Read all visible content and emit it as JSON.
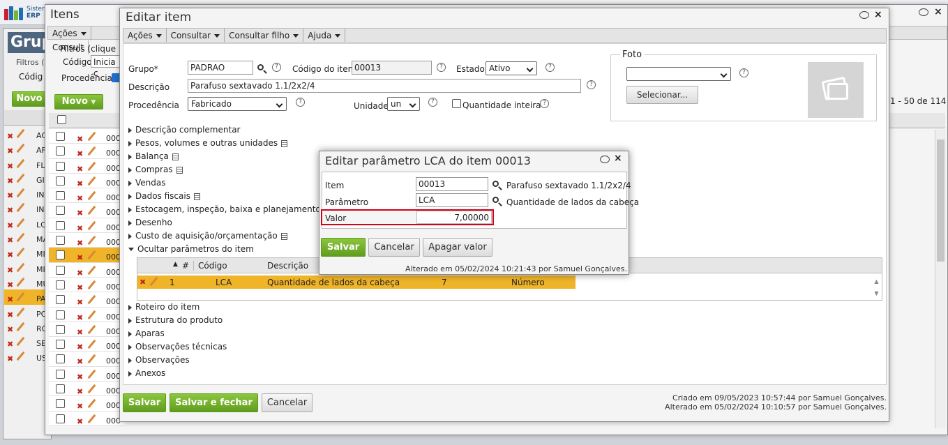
{
  "app": {
    "logo_text_1": "Sister",
    "logo_text_2": "ERP"
  },
  "bg_window": {
    "title": "Grup",
    "filters_label": "Filtros (",
    "codigo_label": "Códig",
    "novo": "Novo",
    "rows": [
      "AC",
      "AF",
      "FL",
      "GI",
      "IN",
      "IN",
      "LC",
      "MA",
      "MI",
      "MI",
      "MU",
      "PA",
      "PC",
      "RÓ",
      "SE",
      "US"
    ]
  },
  "itens_window": {
    "title": "Itens",
    "menu": [
      "Ações",
      "Consult"
    ],
    "filters": "Filtros (clique pa",
    "codigo_label": "Código",
    "codigo_value": "Inicia c",
    "procedencia_label": "Procedência",
    "novo": "Novo",
    "rows": [
      "000",
      "000",
      "000",
      "000",
      "000",
      "000",
      "000",
      "000",
      "000",
      "000",
      "000",
      "000",
      "000",
      "000",
      "000",
      "000",
      "000",
      "000",
      "000",
      "000"
    ],
    "pagination": "1 - 50 de 114"
  },
  "edit_item": {
    "title": "Editar item",
    "menu": [
      "Ações",
      "Consultar",
      "Consultar filho",
      "Ajuda"
    ],
    "grupo_label": "Grupo*",
    "grupo_value": "PADRAO",
    "codigo_label": "Código do item",
    "codigo_value": "00013",
    "estado_label": "Estado",
    "estado_value": "Ativo",
    "descricao_label": "Descrição",
    "descricao_value": "Parafuso sextavado 1.1/2x2/4",
    "procedencia_label": "Procedência",
    "procedencia_value": "Fabricado",
    "unidade_label": "Unidade",
    "unidade_value": "un",
    "quantidade_inteira_label": "Quantidade inteira",
    "foto_label": "Foto",
    "selecionar_label": "Selecionar...",
    "sections_top": [
      {
        "label": "Descrição complementar",
        "doc": false
      },
      {
        "label": "Pesos, volumes e outras unidades",
        "doc": true
      },
      {
        "label": "Balança",
        "doc": true
      },
      {
        "label": "Compras",
        "doc": true
      },
      {
        "label": "Vendas",
        "doc": false
      },
      {
        "label": "Dados fiscais",
        "doc": true
      },
      {
        "label": "Estocagem, inspeção, baixa e planejamento",
        "doc": true
      },
      {
        "label": "Desenho",
        "doc": false
      },
      {
        "label": "Custo de aquisição/orçamentação",
        "doc": true
      }
    ],
    "ocultar_label": "Ocultar parâmetros do item",
    "param_table": {
      "headers": [
        "#",
        "Código",
        "Descrição"
      ],
      "row": {
        "num": "1",
        "codigo": "LCA",
        "descricao": "Quantidade de lados da cabeça",
        "valor": "7",
        "tipo": "Número"
      }
    },
    "sections_bottom": [
      "Roteiro do item",
      "Estrutura do produto",
      "Aparas",
      "Observações técnicas",
      "Observações",
      "Anexos"
    ],
    "salvar": "Salvar",
    "salvar_fechar": "Salvar e fechar",
    "cancelar": "Cancelar",
    "criado": "Criado em 09/05/2023 10:57:44 por Samuel Gonçalves.",
    "alterado": "Alterado em 05/02/2024 10:10:57 por Samuel Gonçalves."
  },
  "lca_dialog": {
    "title": "Editar parâmetro LCA do item 00013",
    "item_label": "Item",
    "item_value": "00013",
    "item_desc": "Parafuso sextavado 1.1/2x2/4",
    "parametro_label": "Parâmetro",
    "parametro_value": "LCA",
    "parametro_desc": "Quantidade de lados da cabeça",
    "valor_label": "Valor",
    "valor_value": "7,00000",
    "salvar": "Salvar",
    "cancelar": "Cancelar",
    "apagar": "Apagar valor",
    "alterado": "Alterado em 05/02/2024 10:21:43 por Samuel Gonçalves."
  },
  "colors": {
    "green": "#6aa826",
    "highlight_row": "#f0b429",
    "red_outline": "#d0021b"
  }
}
